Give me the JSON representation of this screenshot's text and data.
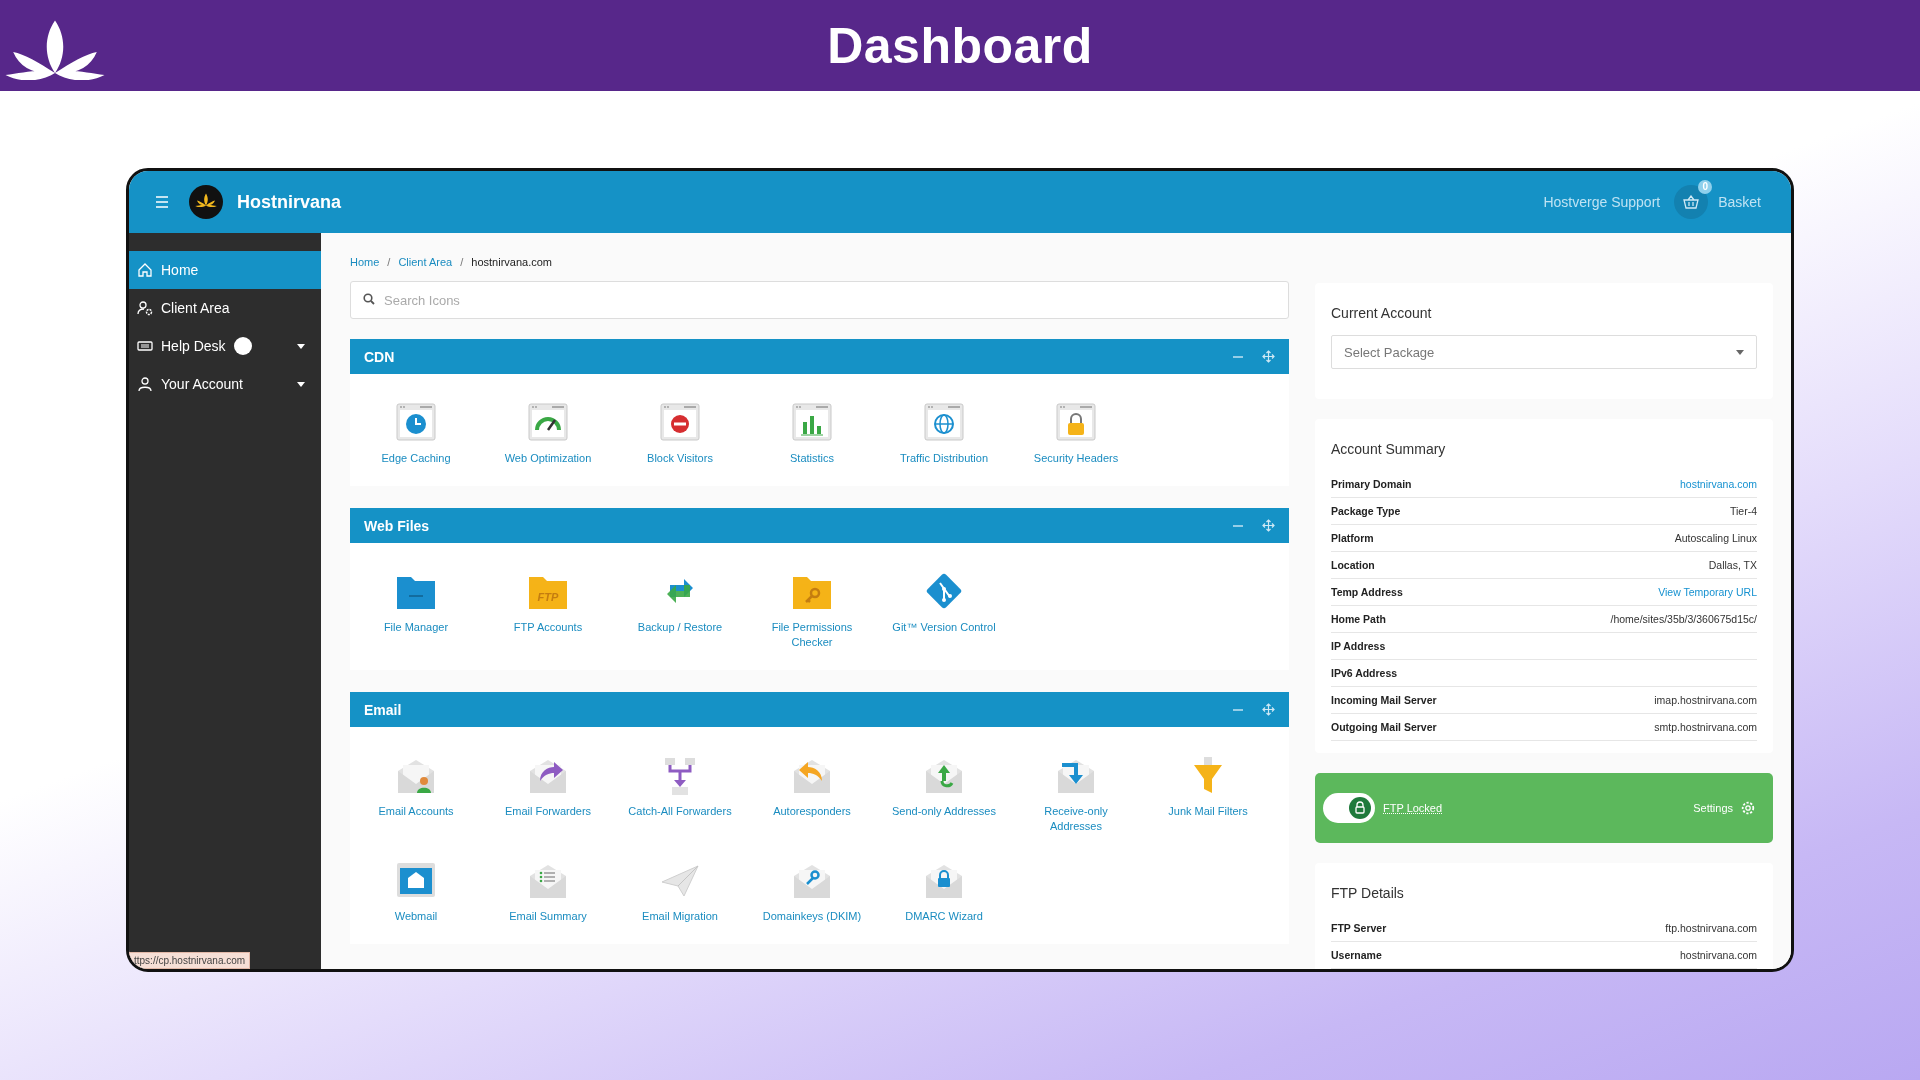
{
  "banner": {
    "title": "Dashboard"
  },
  "app": {
    "brand": "Hostnirvana",
    "support": "Hostverge Support",
    "basket": {
      "label": "Basket",
      "count": "0"
    }
  },
  "sidebar": {
    "items": [
      {
        "label": "Home",
        "selected": true,
        "submenu": false,
        "dot": false
      },
      {
        "label": "Client Area",
        "selected": false,
        "submenu": false,
        "dot": false
      },
      {
        "label": "Help Desk",
        "selected": false,
        "submenu": true,
        "dot": true
      },
      {
        "label": "Your Account",
        "selected": false,
        "submenu": true,
        "dot": false
      }
    ]
  },
  "breadcrumb": [
    {
      "kind": "crumb",
      "label": "Home",
      "current": false
    },
    {
      "kind": "separator",
      "label": "/"
    },
    {
      "kind": "crumb",
      "label": "Client Area",
      "current": false
    },
    {
      "kind": "separator",
      "label": "/"
    },
    {
      "kind": "crumb",
      "label": "hostnirvana.com",
      "current": true
    }
  ],
  "search": {
    "placeholder": "Search Icons"
  },
  "sections": [
    {
      "title": "CDN",
      "items": [
        {
          "label": "Edge Caching"
        },
        {
          "label": "Web Optimization"
        },
        {
          "label": "Block Visitors"
        },
        {
          "label": "Statistics"
        },
        {
          "label": "Traffic Distribution"
        },
        {
          "label": "Security Headers"
        }
      ]
    },
    {
      "title": "Web Files",
      "items": [
        {
          "label": "File Manager"
        },
        {
          "label": "FTP Accounts",
          "icon_text": "FTP"
        },
        {
          "label": "Backup / Restore"
        },
        {
          "label": "File Permissions Checker"
        },
        {
          "label": "Git™ Version Control"
        }
      ]
    },
    {
      "title": "Email",
      "items": [
        {
          "label": "Email Accounts"
        },
        {
          "label": "Email Forwarders"
        },
        {
          "label": "Catch-All Forwarders"
        },
        {
          "label": "Autoresponders"
        },
        {
          "label": "Send-only Addresses"
        },
        {
          "label": "Receive-only Addresses"
        },
        {
          "label": "Junk Mail Filters"
        },
        {
          "label": "Webmail"
        },
        {
          "label": "Email Summary"
        },
        {
          "label": "Email Migration"
        },
        {
          "label": "Domainkeys (DKIM)"
        },
        {
          "label": "DMARC Wizard"
        }
      ]
    }
  ],
  "current_account": {
    "title": "Current Account",
    "placeholder": "Select Package"
  },
  "account_summary": {
    "title": "Account Summary",
    "rows": [
      {
        "label": "Primary Domain",
        "value": "hostnirvana.com",
        "link": true
      },
      {
        "label": "Package Type",
        "value": "Tier-4",
        "link": false
      },
      {
        "label": "Platform",
        "value": "Autoscaling Linux",
        "link": false
      },
      {
        "label": "Location",
        "value": "Dallas, TX",
        "link": false
      },
      {
        "label": "Temp Address",
        "value": "View Temporary URL",
        "link": true
      },
      {
        "label": "Home Path",
        "value": "/home/sites/35b/3/360675d15c/",
        "link": false
      },
      {
        "label": "IP Address"
      },
      {
        "label": "IPv6 Address"
      },
      {
        "label": "Incoming Mail Server",
        "value": "imap.hostnirvana.com",
        "link": false
      },
      {
        "label": "Outgoing Mail Server",
        "value": "smtp.hostnirvana.com",
        "link": false
      }
    ]
  },
  "ftp_lock": {
    "on": true,
    "label": "FTP Locked",
    "settings": "Settings"
  },
  "ftp_details": {
    "title": "FTP Details",
    "rows": [
      {
        "label": "FTP Server",
        "value": "ftp.hostnirvana.com",
        "link": false
      },
      {
        "label": "Username",
        "value": "hostnirvana.com",
        "link": false
      }
    ]
  },
  "status_url": "ttps://cp.hostnirvana.com"
}
